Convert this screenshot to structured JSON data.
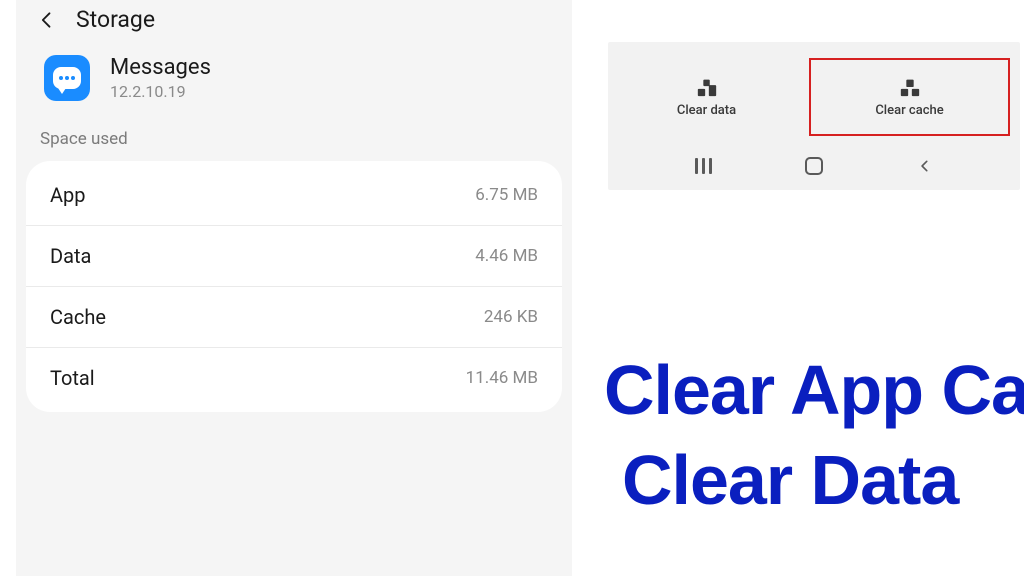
{
  "header": {
    "title": "Storage"
  },
  "app": {
    "name": "Messages",
    "version": "12.2.10.19"
  },
  "section_label": "Space used",
  "storage": [
    {
      "label": "App",
      "value": "6.75 MB"
    },
    {
      "label": "Data",
      "value": "4.46 MB"
    },
    {
      "label": "Cache",
      "value": "246 KB"
    },
    {
      "label": "Total",
      "value": "11.46 MB"
    }
  ],
  "actions": {
    "clear_data": "Clear data",
    "clear_cache": "Clear cache"
  },
  "overlay": {
    "line1": "Clear App Cache",
    "line2": "Clear Data"
  }
}
